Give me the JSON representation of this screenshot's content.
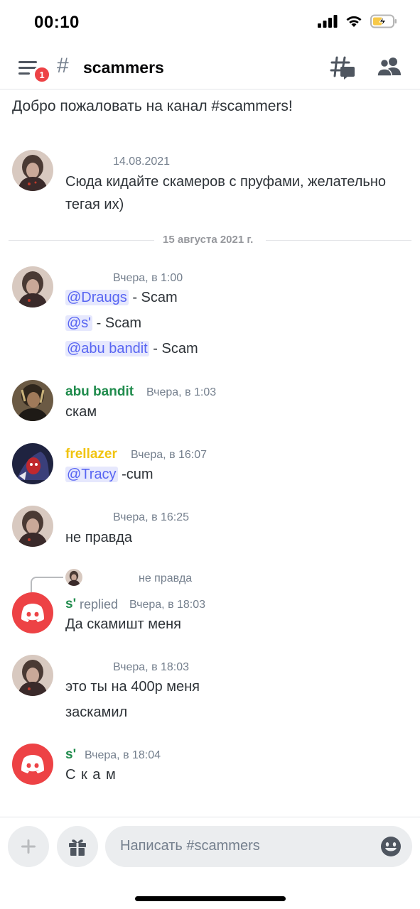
{
  "status_bar": {
    "time": "00:10",
    "battery_state": "charging"
  },
  "header": {
    "menu_badge": "1",
    "hash": "#",
    "channel": "scammers"
  },
  "welcome": "Добро пожаловать на канал #scammers!",
  "date_divider": "15 августа 2021 г.",
  "messages": [
    {
      "avatar": "user-photo-1",
      "author": "",
      "time": "14.08.2021",
      "lines": [
        "Сюда кидайте скамеров с пруфами, желательно",
        "тегая их)"
      ]
    },
    {
      "avatar": "user-photo-1",
      "author": "",
      "time": "Вчера, в 1:00",
      "lines": [
        {
          "mention": "@Draugs",
          "text": " - Scam"
        },
        {
          "mention": "@s'",
          "text": " - Scam"
        },
        {
          "mention": "@abu bandit",
          "text": " - Scam"
        }
      ]
    },
    {
      "avatar": "user-photo-2",
      "author": "abu bandit",
      "author_color": "#1f8b4c",
      "time": "Вчера, в 1:03",
      "lines": [
        "скам"
      ]
    },
    {
      "avatar": "user-photo-3",
      "author": "frellazer",
      "author_color": "#f1c40f",
      "time": "Вчера, в 16:07",
      "lines": [
        {
          "mention": "@Tracy",
          "text": " -cum"
        }
      ]
    },
    {
      "avatar": "user-photo-1",
      "author": "",
      "time": "Вчера, в 16:25",
      "lines": [
        "не правда"
      ]
    },
    {
      "avatar": "discord-logo",
      "author": "s'",
      "author_color": "#1f8b4c",
      "replied_label": "replied",
      "reply_preview": "не правда",
      "time": "Вчера, в 18:03",
      "lines": [
        "Да скамишт меня"
      ]
    },
    {
      "avatar": "user-photo-1",
      "author": "",
      "time": "Вчера, в 18:03",
      "lines": [
        "это ты на 400р меня",
        "заскамил"
      ]
    },
    {
      "avatar": "discord-logo",
      "author": "s'",
      "author_color": "#1f8b4c",
      "time": "Вчера, в 18:04",
      "lines": [
        "С к а м"
      ]
    }
  ],
  "composer": {
    "placeholder": "Написать #scammers"
  },
  "colors": {
    "mention_bg": "#e6e8fd",
    "mention_fg": "#5865f2",
    "discord_red": "#ed4245",
    "green": "#1f8b4c",
    "yellow": "#f1c40f"
  }
}
